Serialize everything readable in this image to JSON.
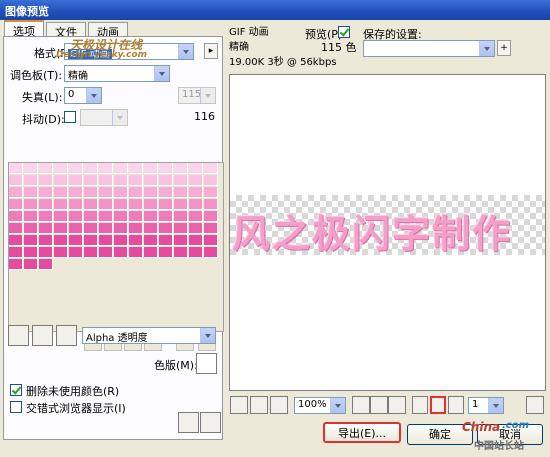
{
  "window": {
    "title": "图像预览"
  },
  "tabs": [
    "选项",
    "文件",
    "动画"
  ],
  "options": {
    "format_label": "格式(F):",
    "format_value": "GIF 动画",
    "palette_label": "调色板(T):",
    "palette_value": "精确",
    "loss_label": "失真(L):",
    "loss_value": "0",
    "colors_value": "115",
    "dither_label": "抖动(D):",
    "dither_count": "116",
    "transparency_value": "Alpha 透明度",
    "matte_label": "色版(M):",
    "remove_unused_label": "删除未使用颜色(R)",
    "remove_unused_checked": true,
    "interlace_label": "交错式浏览器显示(I)",
    "interlace_checked": false
  },
  "info": {
    "format": "GIF 动画",
    "palette": "精确",
    "size_line": "19.00K  3秒 @ 56kbps",
    "preview_label": "预览(P)",
    "preview_checked": true,
    "colors_count": "115 色"
  },
  "saved_settings": {
    "label": "保存的设置:",
    "value": ""
  },
  "preview": {
    "image_text": "风之极闪字制作"
  },
  "zoom": {
    "value": "100%"
  },
  "frame": {
    "value": "1"
  },
  "buttons": {
    "export": "导出(E)...",
    "ok": "确定",
    "cancel": "取消"
  },
  "watermarks": {
    "top": "天极设计在线",
    "top_url": "Design.yesky.com",
    "bottom_brand": "China",
    "bottom_tld": ".com",
    "bottom_sub": "中国站长站"
  },
  "colors": {
    "accent": "#e03030",
    "palette_pinks": [
      "#fbd6ea",
      "#f9c3df",
      "#f6acd3",
      "#f394c6",
      "#ef7bb8",
      "#ea63aa",
      "#e64c9d"
    ]
  }
}
